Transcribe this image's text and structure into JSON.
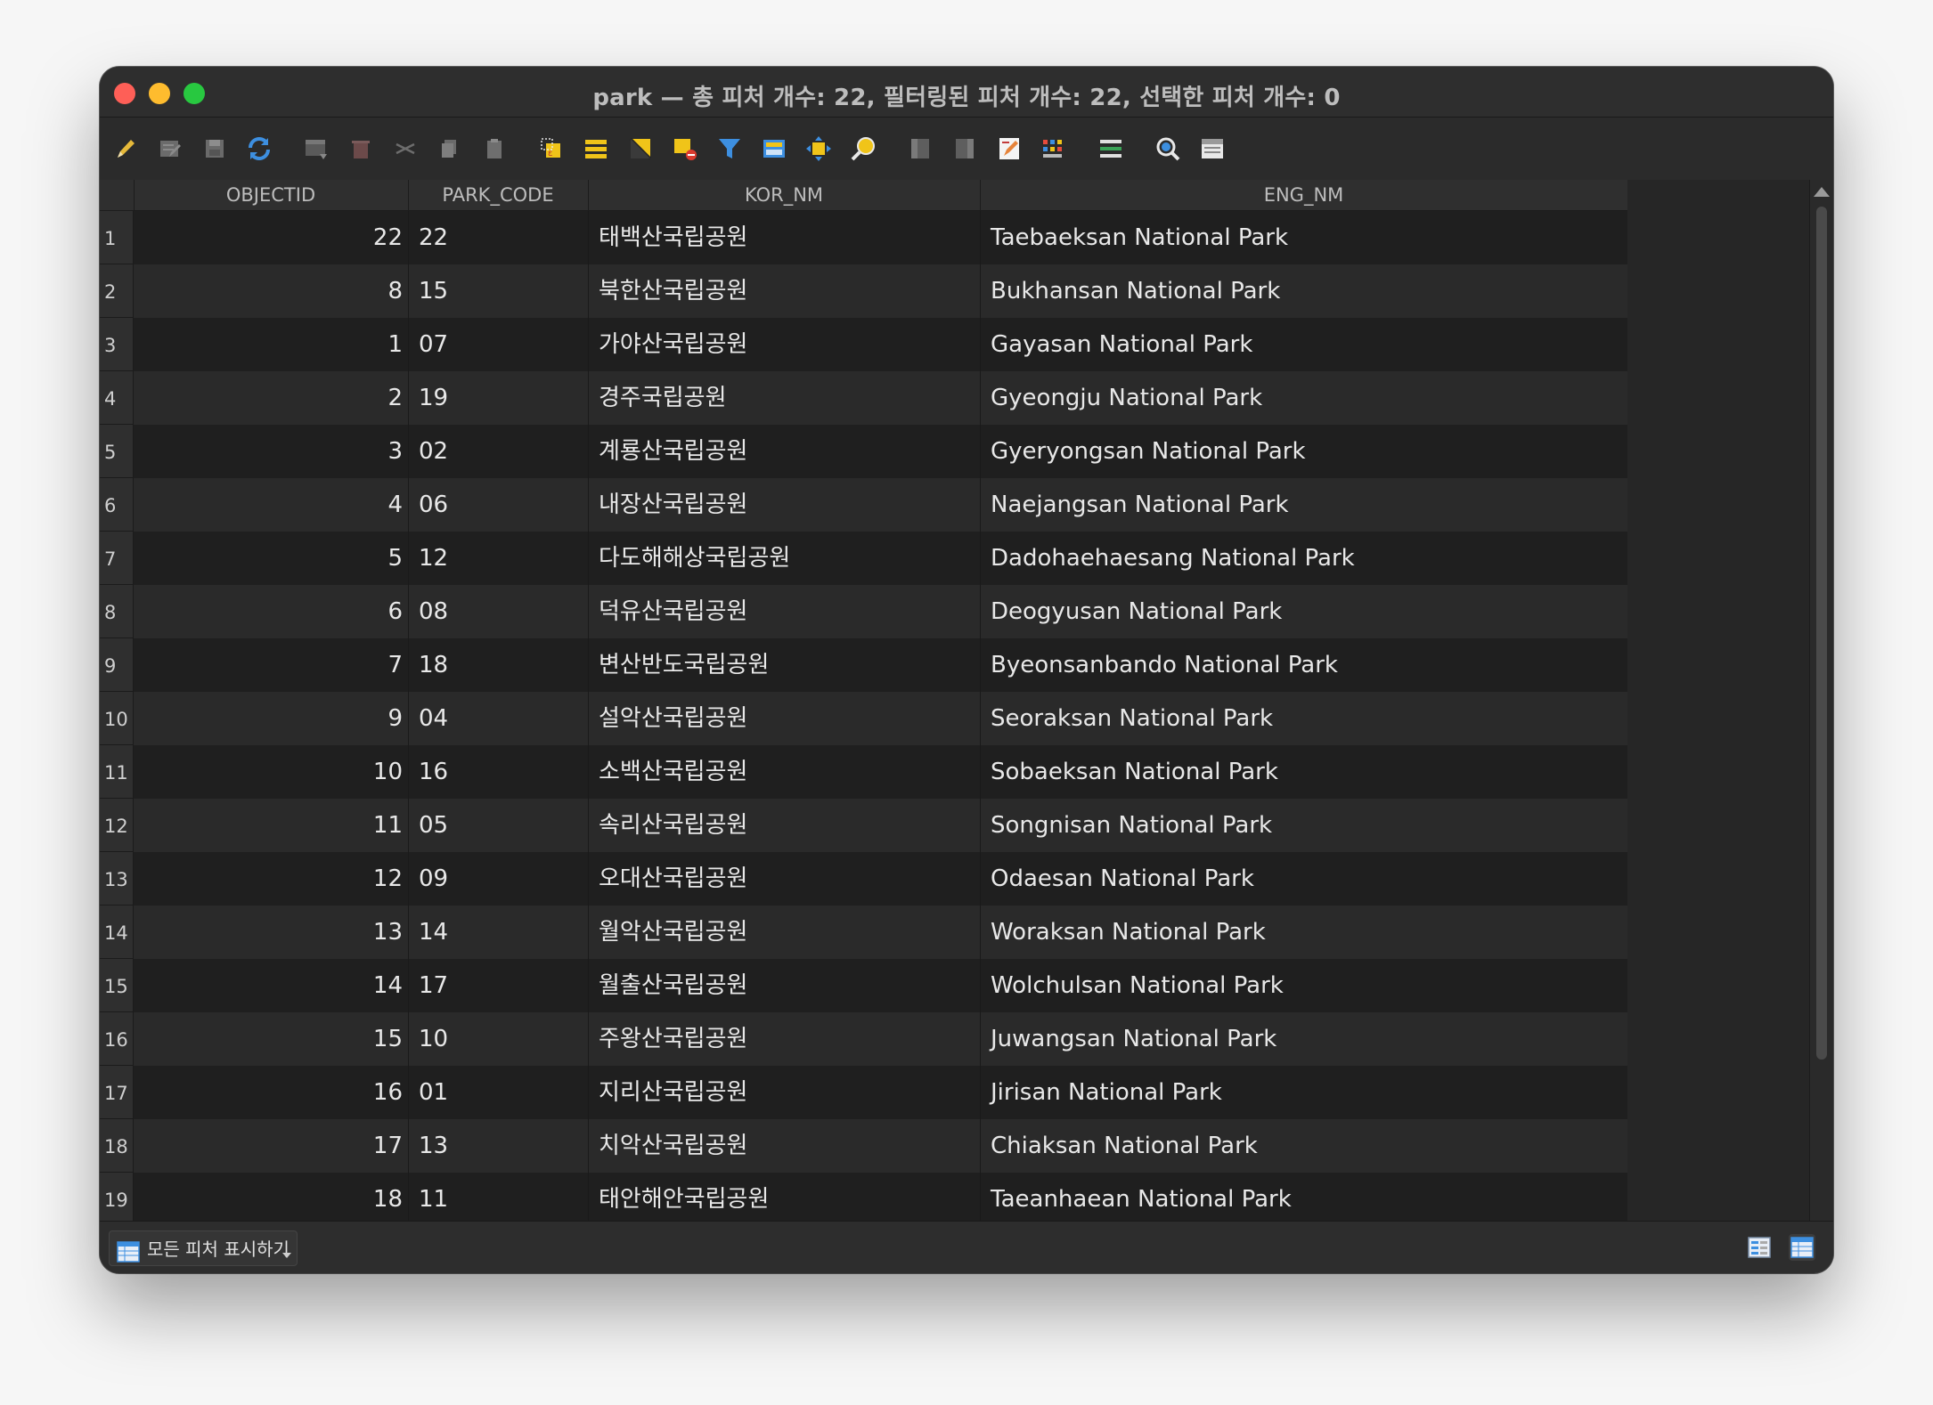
{
  "window": {
    "title": "park — 총 피처 개수: 22, 필터링된 피처 개수: 22, 선택한 피처 개수: 0"
  },
  "toolbar": {
    "icons": [
      "edit-pencil-icon",
      "multi-edit-icon",
      "save-edits-icon",
      "reload-icon",
      "add-feature-icon",
      "delete-feature-icon",
      "cut-icon",
      "copy-icon",
      "paste-icon",
      "select-by-expression-icon",
      "select-all-icon",
      "invert-selection-icon",
      "deselect-icon",
      "filter-icon",
      "move-selection-to-top-icon",
      "pan-to-selected-icon",
      "zoom-to-selected-icon",
      "new-field-icon",
      "delete-field-icon",
      "field-calculator-icon",
      "conditional-formatting-icon",
      "actions-icon",
      "dock-icon",
      "organize-columns-icon"
    ]
  },
  "table": {
    "columns": [
      "OBJECTID",
      "PARK_CODE",
      "KOR_NM",
      "ENG_NM"
    ],
    "rows": [
      {
        "num": "1",
        "objectid": "22",
        "park_code": "22",
        "kor_nm": "태백산국립공원",
        "eng_nm": "Taebaeksan National Park"
      },
      {
        "num": "2",
        "objectid": "8",
        "park_code": "15",
        "kor_nm": "북한산국립공원",
        "eng_nm": "Bukhansan National Park"
      },
      {
        "num": "3",
        "objectid": "1",
        "park_code": "07",
        "kor_nm": "가야산국립공원",
        "eng_nm": "Gayasan National Park"
      },
      {
        "num": "4",
        "objectid": "2",
        "park_code": "19",
        "kor_nm": "경주국립공원",
        "eng_nm": "Gyeongju National Park"
      },
      {
        "num": "5",
        "objectid": "3",
        "park_code": "02",
        "kor_nm": "계룡산국립공원",
        "eng_nm": "Gyeryongsan National Park"
      },
      {
        "num": "6",
        "objectid": "4",
        "park_code": "06",
        "kor_nm": "내장산국립공원",
        "eng_nm": "Naejangsan National Park"
      },
      {
        "num": "7",
        "objectid": "5",
        "park_code": "12",
        "kor_nm": "다도해해상국립공원",
        "eng_nm": "Dadohaehaesang National Park"
      },
      {
        "num": "8",
        "objectid": "6",
        "park_code": "08",
        "kor_nm": "덕유산국립공원",
        "eng_nm": "Deogyusan National Park"
      },
      {
        "num": "9",
        "objectid": "7",
        "park_code": "18",
        "kor_nm": "변산반도국립공원",
        "eng_nm": "Byeonsanbando National Park"
      },
      {
        "num": "10",
        "objectid": "9",
        "park_code": "04",
        "kor_nm": "설악산국립공원",
        "eng_nm": "Seoraksan National Park"
      },
      {
        "num": "11",
        "objectid": "10",
        "park_code": "16",
        "kor_nm": "소백산국립공원",
        "eng_nm": "Sobaeksan National Park"
      },
      {
        "num": "12",
        "objectid": "11",
        "park_code": "05",
        "kor_nm": "속리산국립공원",
        "eng_nm": "Songnisan National Park"
      },
      {
        "num": "13",
        "objectid": "12",
        "park_code": "09",
        "kor_nm": "오대산국립공원",
        "eng_nm": "Odaesan National Park"
      },
      {
        "num": "14",
        "objectid": "13",
        "park_code": "14",
        "kor_nm": "월악산국립공원",
        "eng_nm": "Woraksan National Park"
      },
      {
        "num": "15",
        "objectid": "14",
        "park_code": "17",
        "kor_nm": "월출산국립공원",
        "eng_nm": "Wolchulsan National Park"
      },
      {
        "num": "16",
        "objectid": "15",
        "park_code": "10",
        "kor_nm": "주왕산국립공원",
        "eng_nm": "Juwangsan National Park"
      },
      {
        "num": "17",
        "objectid": "16",
        "park_code": "01",
        "kor_nm": "지리산국립공원",
        "eng_nm": "Jirisan National Park"
      },
      {
        "num": "18",
        "objectid": "17",
        "park_code": "13",
        "kor_nm": "치악산국립공원",
        "eng_nm": "Chiaksan National Park"
      },
      {
        "num": "19",
        "objectid": "18",
        "park_code": "11",
        "kor_nm": "태안해안국립공원",
        "eng_nm": "Taeanhaean National Park"
      }
    ]
  },
  "statusbar": {
    "filter_label": "모든 피처 표시하기"
  },
  "colors": {
    "window_bg": "#262626",
    "row_odd": "#1f1f1f",
    "row_even": "#2a2a2a",
    "text": "#e8e8e8"
  }
}
